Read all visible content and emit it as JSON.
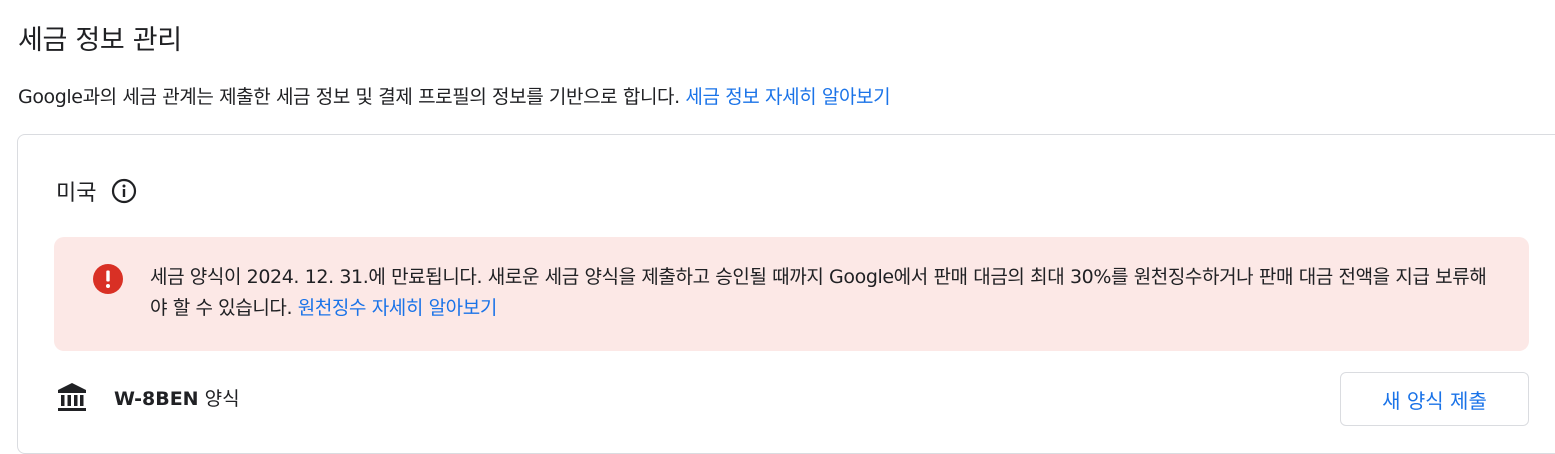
{
  "page": {
    "title": "세금 정보 관리",
    "description": "Google과의 세금 관계는 제출한 세금 정보 및 결제 프로필의 정보를 기반으로 합니다.",
    "learn_more_link": "세금 정보 자세히 알아보기"
  },
  "tax_card": {
    "country": "미국",
    "info_icon": "info-icon",
    "alert": {
      "icon": "error-icon",
      "icon_color": "#d93025",
      "background_color": "#fce8e6",
      "message": "세금 양식이 2024. 12. 31.에 만료됩니다. 새로운 세금 양식을 제출하고 승인될 때까지 Google에서 판매 대금의 최대 30%를 원천징수하거나 판매 대금 전액을 지급 보류해야 할 수 있습니다.",
      "link": "원천징수 자세히 알아보기"
    },
    "form": {
      "icon": "bank-icon",
      "name": "W-8BEN",
      "suffix": "양식",
      "submit_button": "새 양식 제출"
    }
  },
  "colors": {
    "link": "#1a73e8",
    "text": "#202124",
    "border": "#dadce0"
  }
}
